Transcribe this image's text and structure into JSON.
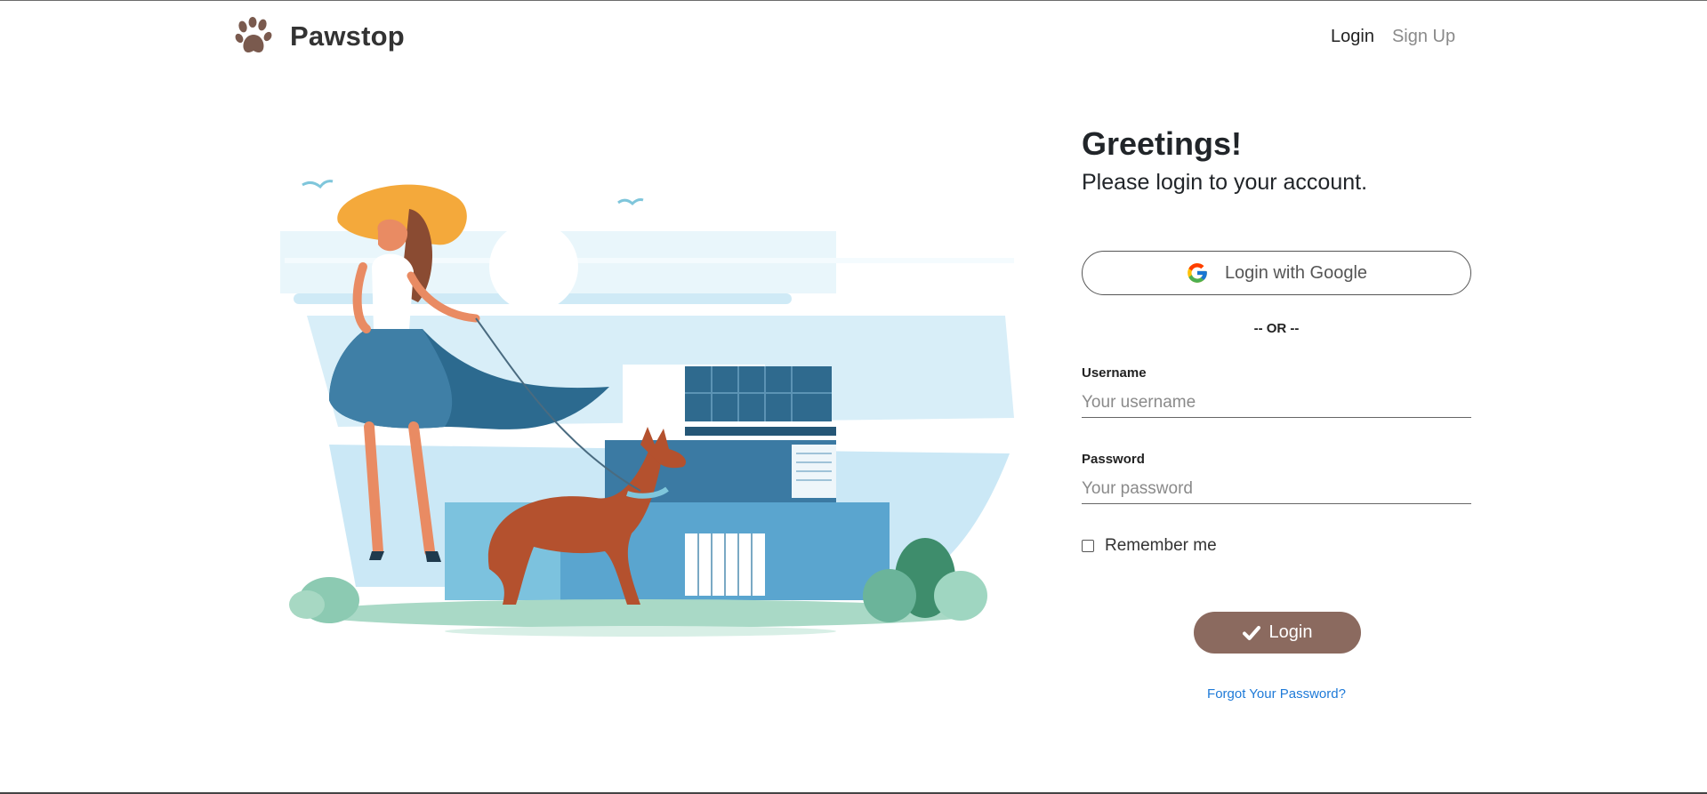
{
  "nav": {
    "brand": "Pawstop",
    "brand_icon": "paw-icon",
    "links": [
      {
        "label": "Login",
        "active": true
      },
      {
        "label": "Sign Up",
        "active": false
      }
    ]
  },
  "illustration": {
    "icon": "woman-walking-doberman-illustration"
  },
  "login": {
    "greeting": "Greetings!",
    "subtitle": "Please login to your account.",
    "google_label": "Login with Google",
    "google_icon": "google-icon",
    "separator": "-- OR --",
    "username_label": "Username",
    "username_placeholder": "Your username",
    "username_value": "",
    "password_label": "Password",
    "password_placeholder": "Your password",
    "password_value": "",
    "remember_label": "Remember me",
    "remember_checked": false,
    "submit_label": "Login",
    "submit_icon": "checkmark-icon",
    "forgot_label": "Forgot Your Password?"
  },
  "colors": {
    "brand_brown": "#8b6a5f",
    "link_blue": "#1e7ad8",
    "inactive_nav": "#8a8a8a"
  }
}
